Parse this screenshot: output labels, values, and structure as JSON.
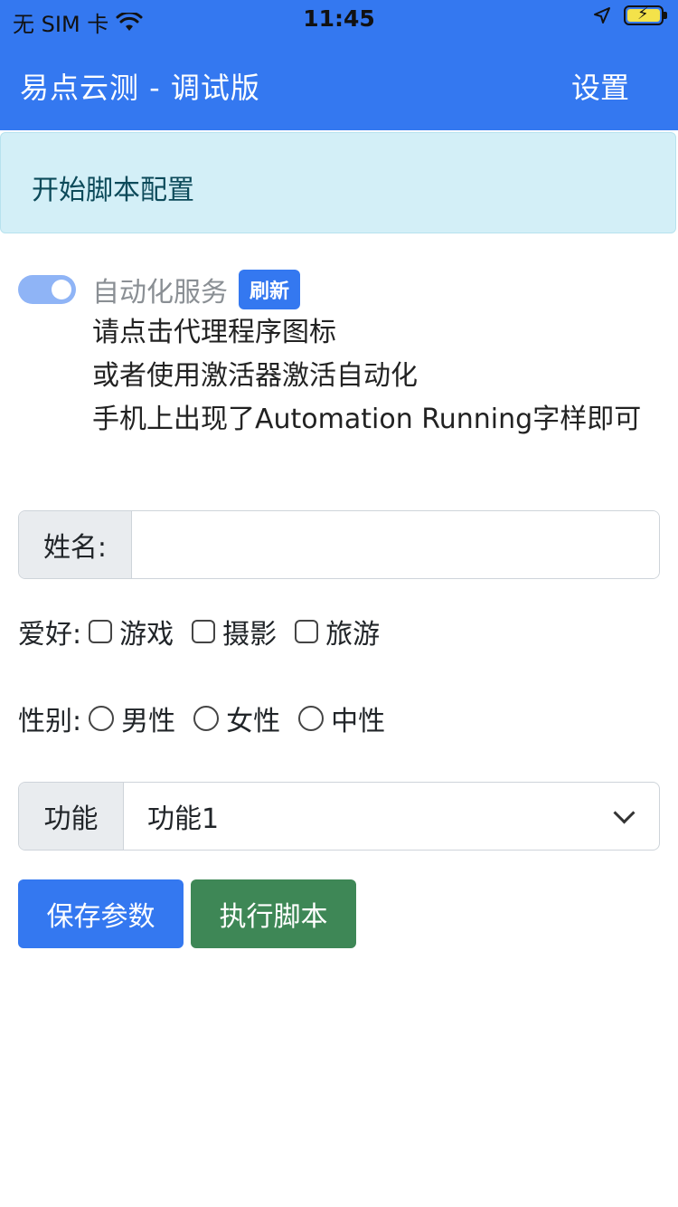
{
  "status_bar": {
    "carrier": "无 SIM 卡",
    "time": "11:45"
  },
  "navbar": {
    "title": "易点云测 - 调试版",
    "settings": "设置"
  },
  "alert": {
    "text": "开始脚本配置"
  },
  "automation": {
    "label": "自动化服务",
    "badge": "刷新",
    "enabled": true,
    "hints": [
      "请点击代理程序图标",
      "或者使用激活器激活自动化",
      "手机上出现了Automation Running字样即可"
    ]
  },
  "name_field": {
    "label": "姓名:",
    "value": "",
    "placeholder": ""
  },
  "hobbies": {
    "label": "爱好:",
    "options": [
      "游戏",
      "摄影",
      "旅游"
    ]
  },
  "gender": {
    "label": "性别:",
    "options": [
      "男性",
      "女性",
      "中性"
    ]
  },
  "function_select": {
    "label": "功能",
    "selected": "功能1"
  },
  "buttons": {
    "save": "保存参数",
    "run": "执行脚本"
  },
  "colors": {
    "primary": "#3478f0",
    "success": "#3e8756",
    "alert_bg": "#d3eff7"
  }
}
